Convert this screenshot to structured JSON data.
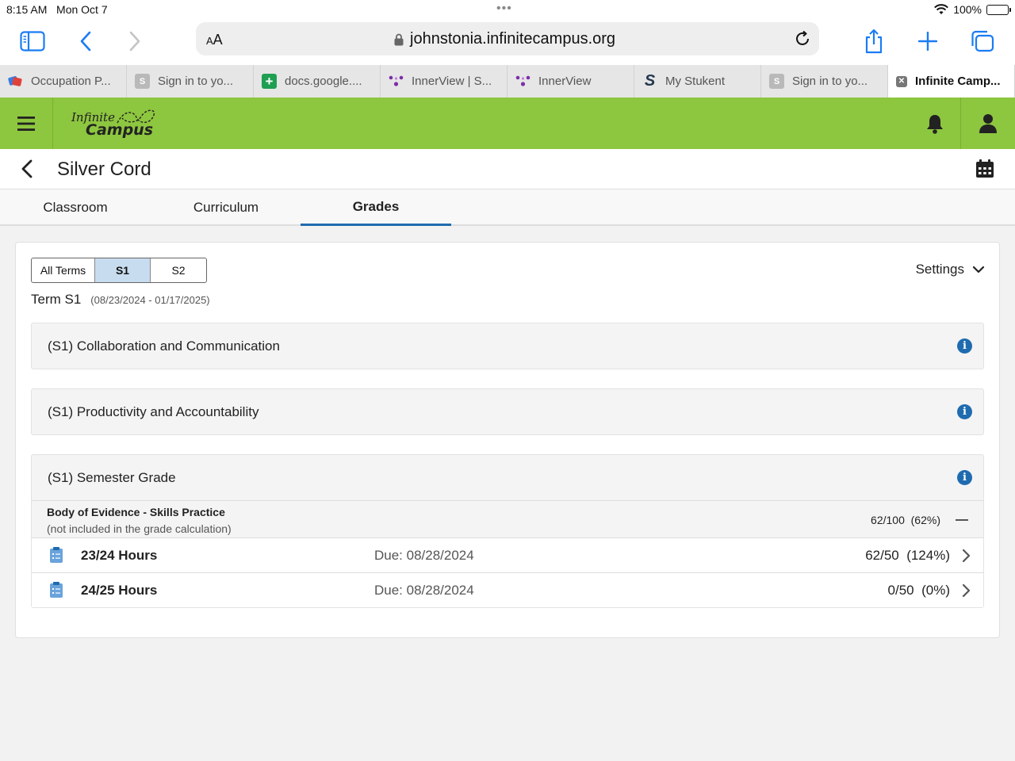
{
  "status": {
    "time": "8:15 AM",
    "date": "Mon Oct 7",
    "battery": "100%"
  },
  "browser": {
    "text_size_label": "AA",
    "url": "johnstonia.infinitecampus.org",
    "tabs": [
      {
        "title": "Occupation P...",
        "icon": "flashcards-icon",
        "color": "#e0413a"
      },
      {
        "title": "Sign in to yo...",
        "icon": "s-icon",
        "color": "#b9b9b9",
        "glyph": "S"
      },
      {
        "title": "docs.google....",
        "icon": "google-sheets-icon",
        "color": "#1e9f51",
        "glyph": "+"
      },
      {
        "title": "InnerView | S...",
        "icon": "innerview-icon",
        "color": "#7b2fa8"
      },
      {
        "title": "InnerView",
        "icon": "innerview-icon",
        "color": "#7b2fa8"
      },
      {
        "title": "My Stukent",
        "icon": "stukent-icon",
        "color": "#23374d",
        "glyph": "S"
      },
      {
        "title": "Sign in to yo...",
        "icon": "s-icon",
        "color": "#b9b9b9",
        "glyph": "S"
      },
      {
        "title": "Infinite Camp...",
        "icon": "close-icon",
        "color": "#777777",
        "glyph": "✕",
        "active": true
      }
    ]
  },
  "app": {
    "logo_line1": "Infinite",
    "logo_line2": "Campus",
    "brand_color": "#8dc63f"
  },
  "course": {
    "title": "Silver Cord"
  },
  "subtabs": [
    "Classroom",
    "Curriculum",
    "Grades"
  ],
  "terms": {
    "options": [
      "All Terms",
      "S1",
      "S2"
    ],
    "selected": "S1"
  },
  "settings_label": "Settings",
  "term_label": "Term S1",
  "term_range": "(08/23/2024 - 01/17/2025)",
  "groups": [
    {
      "title": "(S1) Collaboration and Communication"
    },
    {
      "title": "(S1) Productivity and Accountability"
    },
    {
      "title": "(S1) Semester Grade"
    }
  ],
  "semester": {
    "category_name": "Body of Evidence - Skills Practice",
    "category_note": "(not included in the grade calculation)",
    "category_score": "62/100",
    "category_pct": "(62%)",
    "assignments": [
      {
        "name": "23/24 Hours",
        "due": "Due: 08/28/2024",
        "score": "62/50",
        "pct": "(124%)"
      },
      {
        "name": "24/25 Hours",
        "due": "Due: 08/28/2024",
        "score": "0/50",
        "pct": "(0%)"
      }
    ]
  }
}
